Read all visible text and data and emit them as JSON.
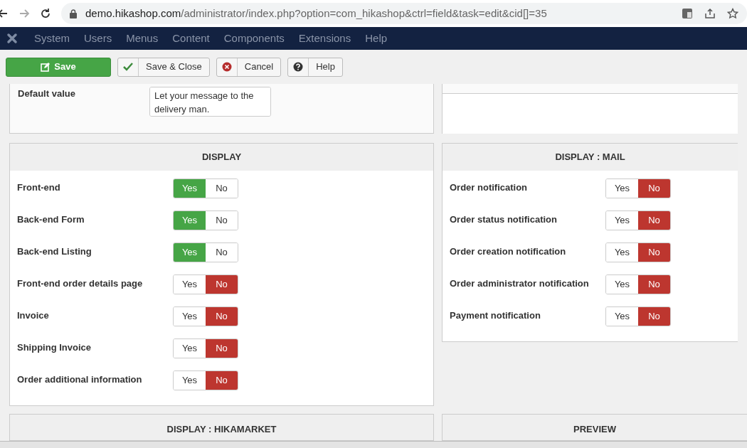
{
  "browser": {
    "url_host": "demo.hikashop.com",
    "url_path": "/administrator/index.php?option=com_hikashop&ctrl=field&task=edit&cid[]=35"
  },
  "nav": {
    "items": [
      "System",
      "Users",
      "Menus",
      "Content",
      "Components",
      "Extensions",
      "Help"
    ]
  },
  "toolbar": [
    {
      "kind": "save",
      "label": "Save"
    },
    {
      "kind": "check",
      "label": "Save & Close"
    },
    {
      "kind": "cancel",
      "label": "Cancel"
    },
    {
      "kind": "help",
      "label": "Help"
    }
  ],
  "default_value": {
    "label": "Default value",
    "value": "Let your message to the delivery man."
  },
  "panels": [
    {
      "title": "DISPLAY",
      "rows": [
        {
          "label": "Front-end",
          "options": [
            {
              "label": "Yes",
              "selected": true
            },
            {
              "label": "No",
              "selected": false
            }
          ]
        },
        {
          "label": "Back-end Form",
          "options": [
            {
              "label": "Yes",
              "selected": true
            },
            {
              "label": "No",
              "selected": false
            }
          ]
        },
        {
          "label": "Back-end Listing",
          "options": [
            {
              "label": "Yes",
              "selected": true
            },
            {
              "label": "No",
              "selected": false
            }
          ]
        },
        {
          "label": "Front-end order details page",
          "options": [
            {
              "label": "Yes",
              "selected": false
            },
            {
              "label": "No",
              "selected": true
            }
          ]
        },
        {
          "label": "Invoice",
          "options": [
            {
              "label": "Yes",
              "selected": false
            },
            {
              "label": "No",
              "selected": true
            }
          ]
        },
        {
          "label": "Shipping Invoice",
          "options": [
            {
              "label": "Yes",
              "selected": false
            },
            {
              "label": "No",
              "selected": true
            }
          ]
        },
        {
          "label": "Order additional information",
          "options": [
            {
              "label": "Yes",
              "selected": false
            },
            {
              "label": "No",
              "selected": true
            }
          ]
        }
      ]
    },
    {
      "title": "DISPLAY : MAIL",
      "rows": [
        {
          "label": "Order notification",
          "options": [
            {
              "label": "Yes",
              "selected": false
            },
            {
              "label": "No",
              "selected": true
            }
          ]
        },
        {
          "label": "Order status notification",
          "options": [
            {
              "label": "Yes",
              "selected": false
            },
            {
              "label": "No",
              "selected": true
            }
          ]
        },
        {
          "label": "Order creation notification",
          "options": [
            {
              "label": "Yes",
              "selected": false
            },
            {
              "label": "No",
              "selected": true
            }
          ]
        },
        {
          "label": "Order administrator notification",
          "options": [
            {
              "label": "Yes",
              "selected": false
            },
            {
              "label": "No",
              "selected": true
            }
          ]
        },
        {
          "label": "Payment notification",
          "options": [
            {
              "label": "Yes",
              "selected": false
            },
            {
              "label": "No",
              "selected": true
            }
          ]
        }
      ]
    }
  ],
  "bottom_panels": [
    "DISPLAY : HIKAMARKET",
    "PREVIEW"
  ]
}
